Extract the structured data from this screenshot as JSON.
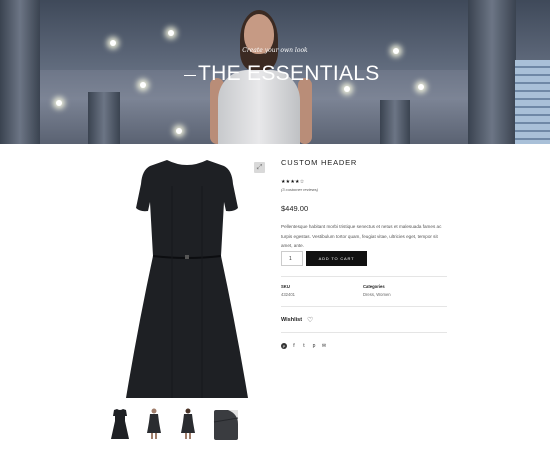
{
  "hero": {
    "subtitle": "Create your own look",
    "title": "THE ESSENTIALS"
  },
  "gallery": {
    "zoom_icon": "zoom-icon",
    "thumbnails": [
      "front",
      "model-front",
      "model-back",
      "fabric-detail"
    ]
  },
  "product": {
    "title": "CUSTOM HEADER",
    "stars": "★★★★☆",
    "rating": 4,
    "reviews": "(3 customer reviews)",
    "price": "$449.00",
    "description": "Pellentesque habitant morbi tristique senectus et netus et malesuada fames ac turpis egestas. Vestibulum tortor quam, feugiat vitae, ultricies eget, tempor sit amet, ante.",
    "quantity": "1",
    "add_to_cart": "ADD TO CART"
  },
  "meta": {
    "sku_label": "SKU",
    "sku_value": "432401",
    "categories_label": "Categories",
    "categories_value": "Dress, Women"
  },
  "wishlist": {
    "label": "Wishlist"
  },
  "social": [
    "pinterest-icon",
    "facebook-icon",
    "twitter-icon",
    "pinterest-p-icon",
    "email-icon"
  ]
}
